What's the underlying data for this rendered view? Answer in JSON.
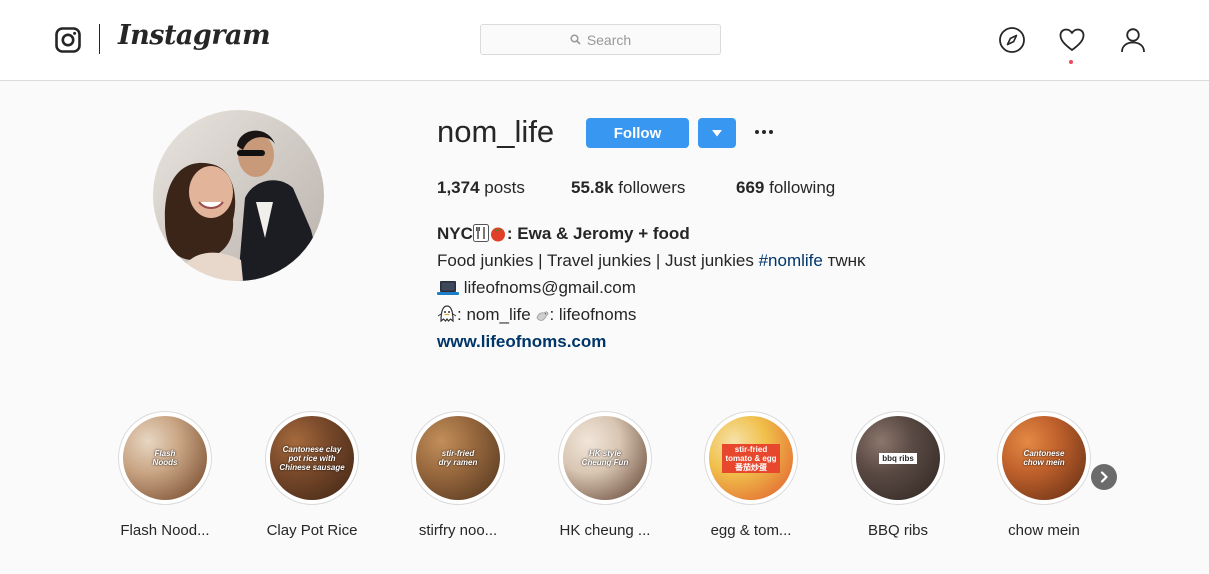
{
  "nav": {
    "wordmark": "Instagram",
    "search_placeholder": "Search"
  },
  "profile": {
    "username": "nom_life",
    "follow_label": "Follow",
    "stats": {
      "posts_count": "1,374",
      "posts_label": " posts",
      "followers_count": "55.8k",
      "followers_label": " followers",
      "following_count": "669",
      "following_label": " following"
    },
    "bio": {
      "name_prefix": "NYC",
      "name_suffix": ": Ewa & Jeromy + food",
      "line1": "Food junkies | Travel junkies | Just junkies ",
      "hashtag": "#nomlife",
      "signoff": " ᴛᴡʜᴋ",
      "email": " lifeofnoms@gmail.com",
      "social_a": ": nom_life ",
      "social_b": ": lifeofnoms",
      "website": "www.lifeofnoms.com"
    }
  },
  "highlights": [
    {
      "label": "Flash Nood...",
      "caption": "Flash\nNoods",
      "style": "plain",
      "colors": [
        "#c9a584",
        "#6b3f22",
        "#e7d6c2"
      ]
    },
    {
      "label": "Clay Pot Rice",
      "caption": "Cantonese clay\npot rice with\nChinese sausage",
      "style": "plain",
      "colors": [
        "#7a4a2b",
        "#3e2414",
        "#a56a3c"
      ]
    },
    {
      "label": "stirfry noo...",
      "caption": "stir-fried\ndry ramen",
      "style": "plain",
      "colors": [
        "#9a6a3f",
        "#4d321c",
        "#c28f5a"
      ]
    },
    {
      "label": "HK cheung ...",
      "caption": "HK style\nCheung Fun",
      "style": "plain",
      "colors": [
        "#d9c6b3",
        "#5a3b2a",
        "#f1e6da"
      ]
    },
    {
      "label": "egg & tom...",
      "caption": "stir-fried\ntomato & egg\n番茄炒蛋",
      "style": "red",
      "colors": [
        "#f0c04a",
        "#e0562e",
        "#f6e1a8"
      ]
    },
    {
      "label": "BBQ ribs",
      "caption": "bbq ribs",
      "style": "tag",
      "colors": [
        "#5a4a44",
        "#2e2420",
        "#8a766c"
      ]
    },
    {
      "label": "chow mein",
      "caption": "Cantonese\nchow mein",
      "style": "plain",
      "colors": [
        "#c0612c",
        "#5c2a12",
        "#e38a45"
      ]
    }
  ],
  "colors": {
    "follow_blue": "#3897f0",
    "link_blue": "#003569",
    "notification_red": "#ed4956"
  }
}
